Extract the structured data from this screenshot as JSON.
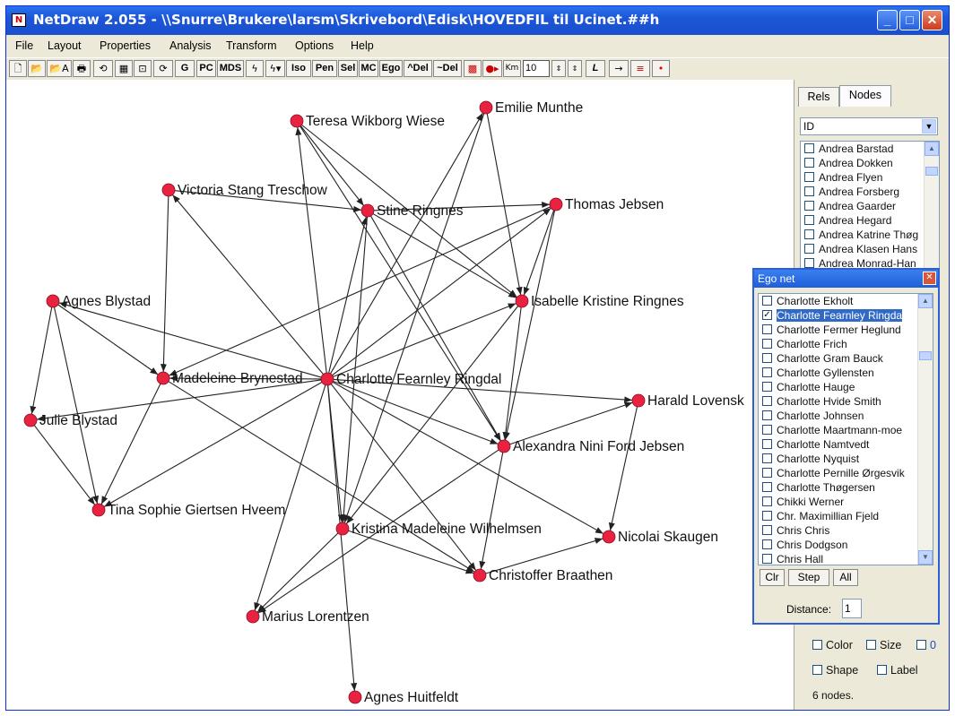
{
  "window": {
    "title": "NetDraw 2.055 - \\\\Snurre\\Brukere\\larsm\\Skrivebord\\Edisk\\HOVEDFIL til Ucinet.##h"
  },
  "menu": [
    "File",
    "Layout",
    "Properties",
    "Analysis",
    "Transform",
    "Options",
    "Help"
  ],
  "toolbar": {
    "labels": [
      "G",
      "PC",
      "MDS",
      "Iso",
      "Pen",
      "Sel",
      "MC",
      "Ego",
      "^Del",
      "~Del",
      "L"
    ],
    "nodesize_value": "10"
  },
  "colors": {
    "node": "#e8223f",
    "edge": "#222222",
    "titlebar": "#1f5ad8",
    "selection": "#316ac5"
  },
  "network": {
    "nodes": [
      {
        "id": "teresa",
        "label": "Teresa Wikborg Wiese"
      },
      {
        "id": "emilie",
        "label": "Emilie Munthe"
      },
      {
        "id": "victoria",
        "label": "Victoria Stang Treschow"
      },
      {
        "id": "stine",
        "label": "Stine Ringnes"
      },
      {
        "id": "thomas",
        "label": "Thomas Jebsen"
      },
      {
        "id": "agnesb",
        "label": "Agnes Blystad"
      },
      {
        "id": "isabelle",
        "label": "Isabelle Kristine Ringnes"
      },
      {
        "id": "madeleine",
        "label": "Madeleine Brynestad"
      },
      {
        "id": "charlotte",
        "label": "Charlotte Fearnley Ringdal"
      },
      {
        "id": "harald",
        "label": "Harald Lovensk"
      },
      {
        "id": "julie",
        "label": "Julie Blystad"
      },
      {
        "id": "alexandra",
        "label": "Alexandra Nini Ford Jebsen"
      },
      {
        "id": "tina",
        "label": "Tina Sophie Giertsen Hveem"
      },
      {
        "id": "kristina",
        "label": "Kristina Madeleine Wilhelmsen"
      },
      {
        "id": "nicolai",
        "label": "Nicolai Skaugen"
      },
      {
        "id": "christoffer",
        "label": "Christoffer Braathen"
      },
      {
        "id": "marius",
        "label": "Marius Lorentzen"
      },
      {
        "id": "agnesh",
        "label": "Agnes Huitfeldt"
      }
    ],
    "edges": [
      [
        "charlotte",
        "teresa"
      ],
      [
        "charlotte",
        "emilie"
      ],
      [
        "charlotte",
        "victoria"
      ],
      [
        "charlotte",
        "stine"
      ],
      [
        "charlotte",
        "thomas"
      ],
      [
        "charlotte",
        "agnesb"
      ],
      [
        "charlotte",
        "isabelle"
      ],
      [
        "charlotte",
        "madeleine"
      ],
      [
        "charlotte",
        "harald"
      ],
      [
        "charlotte",
        "julie"
      ],
      [
        "charlotte",
        "alexandra"
      ],
      [
        "charlotte",
        "tina"
      ],
      [
        "charlotte",
        "kristina"
      ],
      [
        "charlotte",
        "nicolai"
      ],
      [
        "charlotte",
        "christoffer"
      ],
      [
        "charlotte",
        "marius"
      ],
      [
        "charlotte",
        "agnesh"
      ],
      [
        "teresa",
        "stine"
      ],
      [
        "teresa",
        "isabelle"
      ],
      [
        "teresa",
        "alexandra"
      ],
      [
        "emilie",
        "isabelle"
      ],
      [
        "emilie",
        "kristina"
      ],
      [
        "victoria",
        "stine"
      ],
      [
        "victoria",
        "madeleine"
      ],
      [
        "stine",
        "thomas"
      ],
      [
        "stine",
        "isabelle"
      ],
      [
        "stine",
        "alexandra"
      ],
      [
        "stine",
        "kristina"
      ],
      [
        "thomas",
        "isabelle"
      ],
      [
        "thomas",
        "alexandra"
      ],
      [
        "thomas",
        "madeleine"
      ],
      [
        "isabelle",
        "alexandra"
      ],
      [
        "isabelle",
        "kristina"
      ],
      [
        "agnesb",
        "julie"
      ],
      [
        "agnesb",
        "madeleine"
      ],
      [
        "agnesb",
        "tina"
      ],
      [
        "julie",
        "tina"
      ],
      [
        "madeleine",
        "tina"
      ],
      [
        "madeleine",
        "christoffer"
      ],
      [
        "alexandra",
        "harald"
      ],
      [
        "alexandra",
        "christoffer"
      ],
      [
        "alexandra",
        "marius"
      ],
      [
        "harald",
        "nicolai"
      ],
      [
        "kristina",
        "christoffer"
      ],
      [
        "christoffer",
        "nicolai"
      ],
      [
        "kristina",
        "marius"
      ]
    ]
  },
  "rightpanel": {
    "tabs": [
      "Rels",
      "Nodes"
    ],
    "attribute_select": "ID",
    "nodes": [
      "Andrea Barstad",
      "Andrea Dokken",
      "Andrea Flyen",
      "Andrea Forsberg",
      "Andrea Gaarder",
      "Andrea Hegard",
      "Andrea Katrine Thøg",
      "Andrea Klasen Hans",
      "Andrea Monrad-Han"
    ],
    "options": {
      "color": "Color",
      "size": "Size",
      "shape": "Shape",
      "label": "Label",
      "extra": "0"
    },
    "status": "6 nodes."
  },
  "ego": {
    "title": "Ego net",
    "items": [
      "Charlotte Ekholt",
      "Charlotte Fearnley Ringda",
      "Charlotte Fermer Heglund",
      "Charlotte Frich",
      "Charlotte Gram Bauck",
      "Charlotte Gyllensten",
      "Charlotte Hauge",
      "Charlotte Hvide Smith",
      "Charlotte Johnsen",
      "Charlotte Maartmann-moe",
      "Charlotte Namtvedt",
      "Charlotte Nyquist",
      "Charlotte Pernille Ørgesvik",
      "Charlotte Thøgersen",
      "Chikki Werner",
      "Chr. Maximillian Fjeld",
      "Chris Chris",
      "Chris Dodgson",
      "Chris Hall"
    ],
    "selected_index": 1,
    "buttons": {
      "clr": "Clr",
      "step": "Step",
      "all": "All"
    },
    "distance_label": "Distance:",
    "distance_value": "1"
  }
}
